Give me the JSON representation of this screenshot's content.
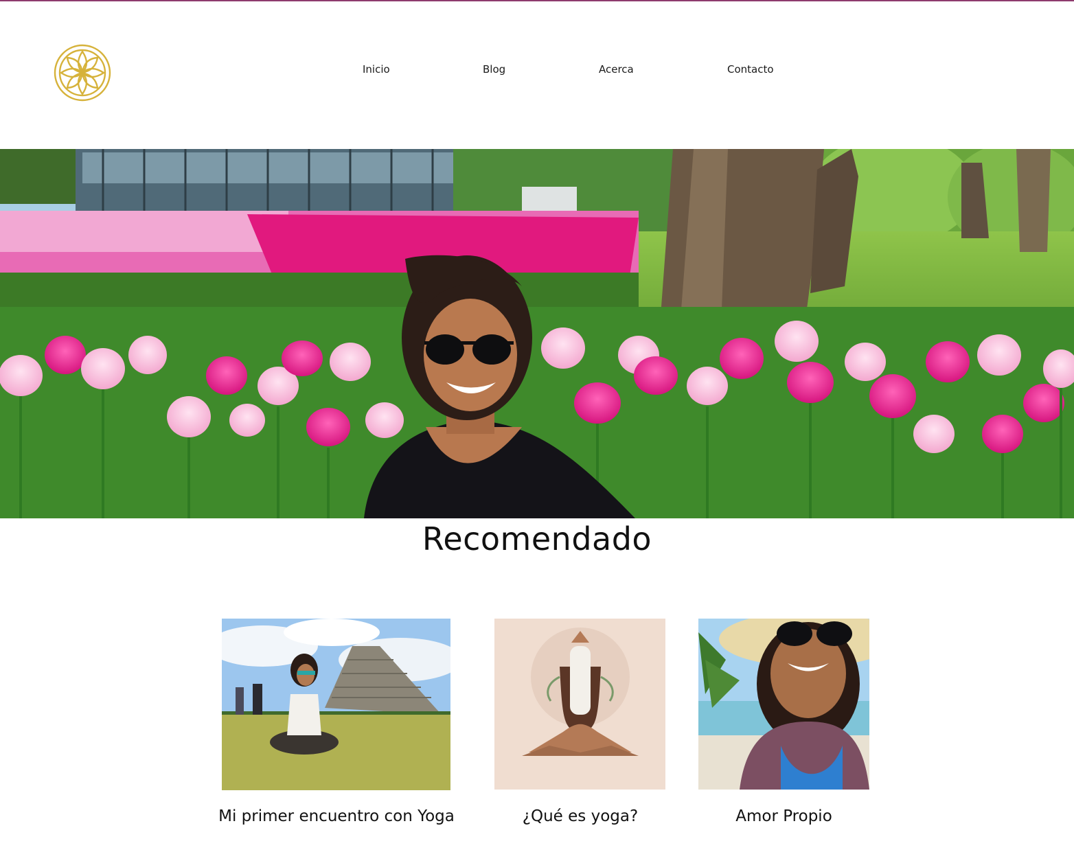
{
  "brand": {
    "logo_icon": "lotus-flower-icon",
    "accent": "#d6b23a",
    "top_rule_color": "#8e3a6d"
  },
  "nav": {
    "items": [
      {
        "label": "Inicio"
      },
      {
        "label": "Blog"
      },
      {
        "label": "Acerca"
      },
      {
        "label": "Contacto"
      }
    ]
  },
  "hero": {
    "image": "woman-with-sunglasses-in-tulip-garden"
  },
  "recommended": {
    "heading": "Recomendado",
    "posts": [
      {
        "title": "Mi primer encuentro con Yoga",
        "image": "meditating-in-front-of-pyramid"
      },
      {
        "title": "¿Qué es yoga?",
        "image": "yoga-pose-illustration"
      },
      {
        "title": "Amor Propio",
        "image": "beach-selfie-with-hat"
      }
    ]
  }
}
